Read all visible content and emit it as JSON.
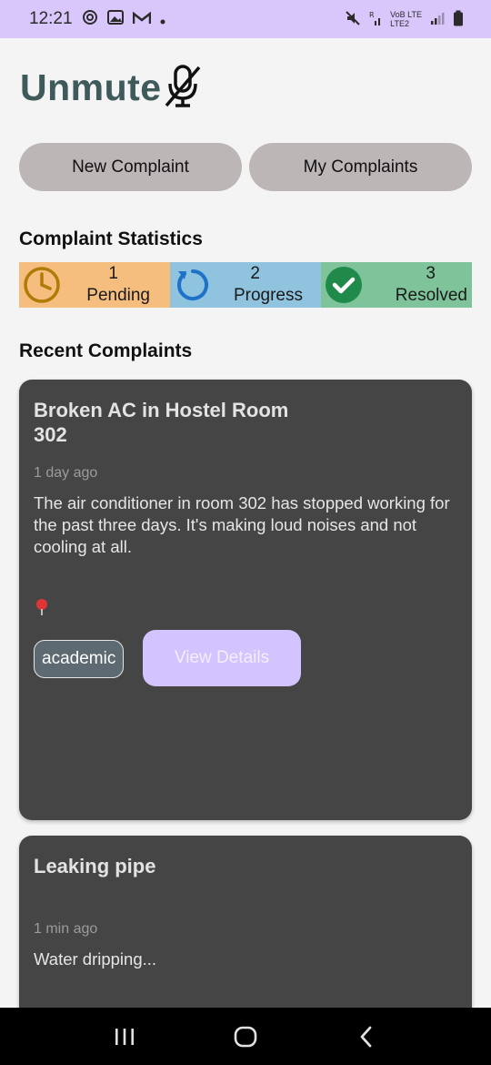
{
  "status_bar": {
    "time": "12:21",
    "left_icons": [
      "settings-sync-icon",
      "gallery-icon",
      "gmail-icon",
      "dot-icon"
    ],
    "right_icons": [
      "mute-icon",
      "signal-r-icon",
      "volte-lte-icon",
      "signal-bars-icon",
      "battery-icon"
    ],
    "network_top": "VoB LTE",
    "network_bottom": "LTE2"
  },
  "app": {
    "logo_text": "Unmute",
    "logo_icon": "mic-off-icon"
  },
  "actions": {
    "new_complaint": "New Complaint",
    "my_complaints": "My Complaints"
  },
  "stats": {
    "title": "Complaint Statistics",
    "items": [
      {
        "count": "1",
        "label": "Pending",
        "icon": "clock-icon",
        "color": "#f5be7e"
      },
      {
        "count": "2",
        "label": "Progress",
        "icon": "refresh-icon",
        "color": "#8fc3de"
      },
      {
        "count": "3",
        "label": "Resolved",
        "icon": "check-circle-icon",
        "color": "#7ec39a"
      }
    ]
  },
  "recent": {
    "title": "Recent Complaints",
    "complaints": [
      {
        "title": "Broken AC in Hostel Room 302",
        "time": "1 day ago",
        "description": "The air conditioner in room 302 has stopped working for the past three days. It's making loud noises and not cooling at all.",
        "location_icon": "location-pin-icon",
        "category": "academic",
        "action": "View Details"
      },
      {
        "title": "Leaking pipe",
        "time": "1 min ago",
        "description": "Water dripping..."
      }
    ]
  },
  "nav": {
    "items": [
      "recents-icon",
      "home-icon",
      "back-icon"
    ]
  },
  "colors": {
    "status_bar": "#d9c7fb",
    "accent": "#d3c3ff",
    "card": "#454545",
    "logo": "#3f5a5a"
  }
}
